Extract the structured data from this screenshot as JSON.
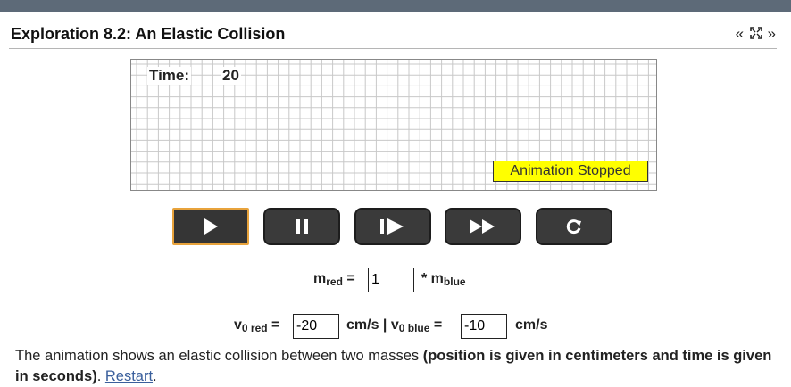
{
  "header": {
    "title": "Exploration 8.2: An Elastic Collision",
    "prev_symbol": "«",
    "fullscreen_symbol": "⛶",
    "next_symbol": "»"
  },
  "simulation": {
    "time_label": "Time:",
    "time_value": "20",
    "status": "Animation Stopped"
  },
  "controls": {
    "buttons": [
      "play-icon",
      "pause-icon",
      "step-forward-icon",
      "fast-forward-icon",
      "reset-icon"
    ]
  },
  "mass_row": {
    "m": "m",
    "red_sub": "red",
    "equals": " =",
    "value": "1",
    "times": "* m",
    "blue_sub": "blue"
  },
  "velocity_row": {
    "v": "v",
    "red_sub": "0 red",
    "equals": " =",
    "v_red_value": "-20",
    "mid_text": "cm/s | v",
    "blue_sub": "0 blue",
    "equals2": " =",
    "v_blue_value": "-10",
    "unit": "cm/s"
  },
  "description": {
    "text1": "The animation shows an elastic collision between two masses ",
    "bold": "(position is given in centimeters and time is given in seconds)",
    "text2": ". ",
    "link": "Restart",
    "text3": "."
  },
  "colors": {
    "topbar": "#5d6a78",
    "status_bg": "#ffff00",
    "button_bg": "#3a3a3a",
    "active_border": "#e8a33c",
    "grid": "#c8c8c8",
    "link": "#3a5f9c"
  }
}
